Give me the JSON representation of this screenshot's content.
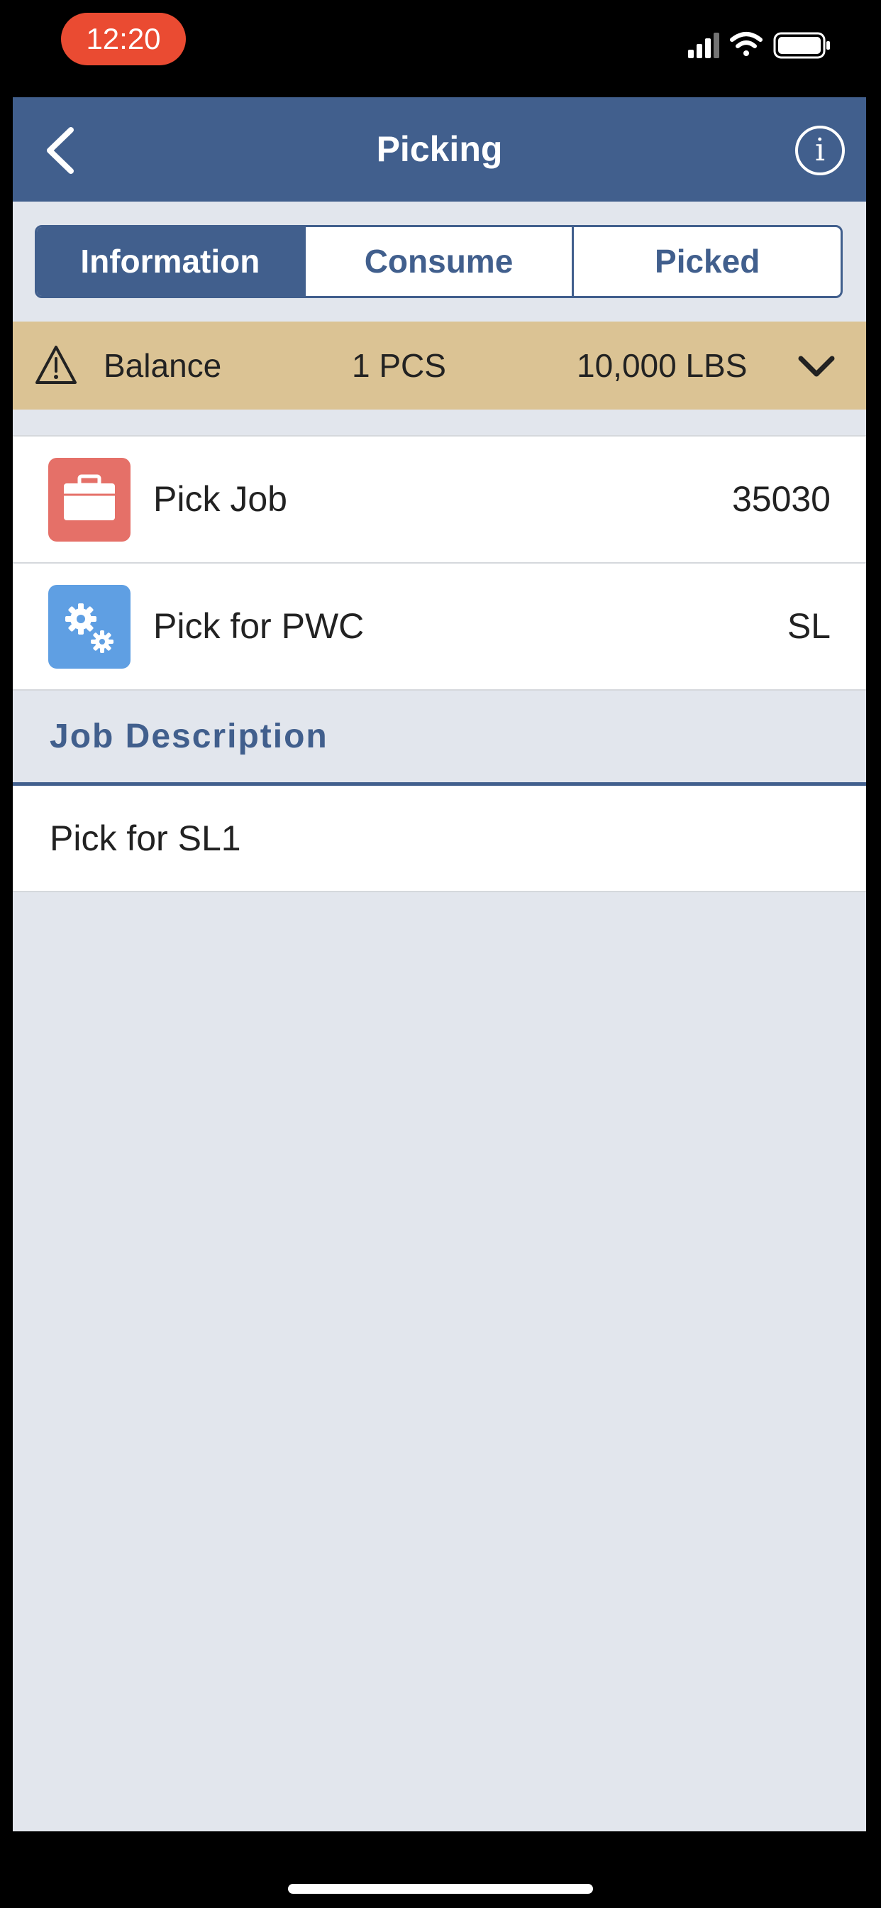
{
  "status_bar": {
    "time": "12:20"
  },
  "nav": {
    "title": "Picking"
  },
  "tabs": [
    {
      "label": "Information",
      "active": true
    },
    {
      "label": "Consume",
      "active": false
    },
    {
      "label": "Picked",
      "active": false
    }
  ],
  "balance": {
    "label": "Balance",
    "pcs": "1 PCS",
    "lbs": "10,000 LBS"
  },
  "rows": [
    {
      "label": "Pick Job",
      "value": "35030",
      "icon": "briefcase-icon",
      "icon_color": "#e57068"
    },
    {
      "label": "Pick for PWC",
      "value": "SL",
      "icon": "gears-icon",
      "icon_color": "#5f9fe3"
    }
  ],
  "job_description": {
    "header": "Job Description",
    "text": "Pick for SL1"
  },
  "colors": {
    "nav": "#415f8d",
    "balance_bar": "#dbc394",
    "background": "#e2e6ed",
    "time_pill": "#ea4b32"
  }
}
